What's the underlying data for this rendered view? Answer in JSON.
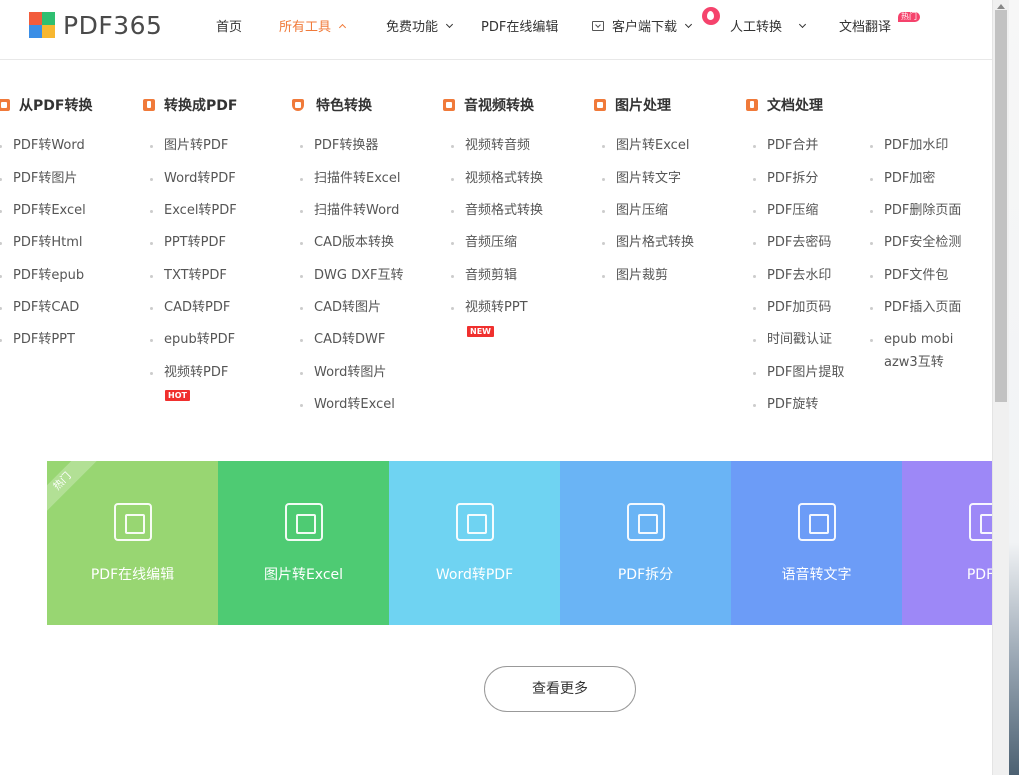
{
  "logo": {
    "text": "PDF365",
    "colors": [
      "#f25c3c",
      "#2fbf71",
      "#3a8ee6",
      "#f7b731"
    ]
  },
  "nav": {
    "items": [
      {
        "label": "首页"
      },
      {
        "label": "所有工具"
      },
      {
        "label": "免费功能"
      },
      {
        "label": "PDF在线编辑"
      },
      {
        "label": "客户端下载"
      },
      {
        "label": "人工转换"
      },
      {
        "label": "文档翻译"
      }
    ],
    "hot_badge": "热门",
    "accent_color": "#f07a3a"
  },
  "menu": {
    "columns": [
      {
        "title": "从PDF转换",
        "icon": "convert-from-pdf-icon",
        "items": [
          "PDF转Word",
          "PDF转图片",
          "PDF转Excel",
          "PDF转Html",
          "PDF转epub",
          "PDF转CAD",
          "PDF转PPT"
        ]
      },
      {
        "title": "转换成PDF",
        "icon": "convert-to-pdf-icon",
        "items": [
          "图片转PDF",
          "Word转PDF",
          "Excel转PDF",
          "PPT转PDF",
          "TXT转PDF",
          "CAD转PDF",
          "epub转PDF",
          "视频转PDF"
        ],
        "tag": "HOT"
      },
      {
        "title": "特色转换",
        "icon": "shield-icon",
        "items": [
          "PDF转换器",
          "扫描件转Excel",
          "扫描件转Word",
          "CAD版本转换",
          "DWG DXF互转",
          "CAD转图片",
          "CAD转DWF",
          "Word转图片",
          "Word转Excel"
        ]
      },
      {
        "title": "音视频转换",
        "icon": "video-icon",
        "items": [
          "视频转音频",
          "视频格式转换",
          "音频格式转换",
          "音频压缩",
          "音频剪辑",
          "视频转PPT"
        ],
        "tag": "NEW"
      },
      {
        "title": "图片处理",
        "icon": "image-icon",
        "items": [
          "图片转Excel",
          "图片转文字",
          "图片压缩",
          "图片格式转换",
          "图片裁剪"
        ]
      },
      {
        "title": "文档处理",
        "icon": "document-icon",
        "items": [
          "PDF合并",
          "PDF拆分",
          "PDF压缩",
          "PDF去密码",
          "PDF去水印",
          "PDF加页码",
          "时间戳认证",
          "PDF图片提取",
          "PDF旋转"
        ],
        "items2": [
          "PDF加水印",
          "PDF加密",
          "PDF删除页面",
          "PDF安全检测",
          "PDF文件包",
          "PDF插入页面",
          "epub mobi",
          "azw3互转"
        ]
      }
    ]
  },
  "tiles": {
    "ribbon": "热门",
    "items": [
      {
        "label": "PDF在线编辑",
        "color": "#98d672"
      },
      {
        "label": "图片转Excel",
        "color": "#4ecb73"
      },
      {
        "label": "Word转PDF",
        "color": "#6fd3f2"
      },
      {
        "label": "PDF拆分",
        "color": "#6ab4f5"
      },
      {
        "label": "语音转文字",
        "color": "#6c9cf7"
      },
      {
        "label": "PDF加",
        "color": "#9d88f7"
      }
    ]
  },
  "more_button": {
    "label": "查看更多"
  }
}
